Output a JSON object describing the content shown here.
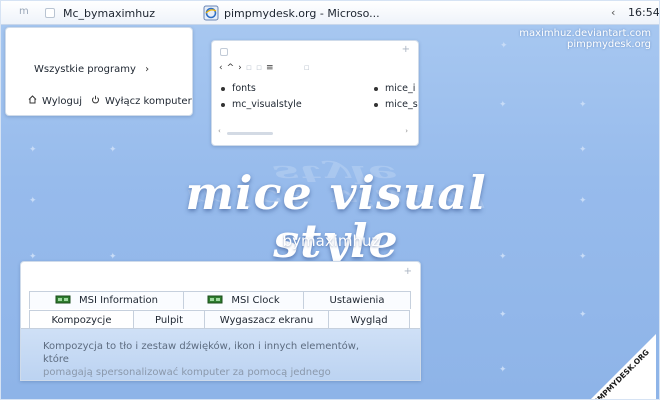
{
  "taskbar": {
    "start_glyph": "m",
    "items": [
      {
        "label": "Mc_bymaximhuz"
      },
      {
        "label": "pimpmydesk.org - Microso..."
      }
    ],
    "tray_arrow": "‹",
    "clock": "16:54"
  },
  "credits": {
    "line1": "maximhuz.deviantart.com",
    "line2": "pimpmydesk.org"
  },
  "start_menu": {
    "all_programs": "Wszystkie programy",
    "all_programs_arrow": "›",
    "logout": "Wyloguj",
    "shutdown": "Wyłącz komputer"
  },
  "explorer": {
    "plus": "+",
    "nav_back": "‹",
    "nav_up": "^",
    "nav_forward": "›",
    "files": [
      {
        "name": "fonts"
      },
      {
        "name": "mc_visualstyle"
      },
      {
        "name": "mice_i"
      },
      {
        "name": "mice_s"
      }
    ]
  },
  "hero": {
    "title": "mice visual style",
    "subtitle": "bymaximhuz"
  },
  "control_panel": {
    "plus": "+",
    "tabs_top": [
      {
        "label": "MSI Information"
      },
      {
        "label": "MSI Clock"
      },
      {
        "label": "Ustawienia"
      }
    ],
    "tabs_bottom": [
      {
        "label": "Kompozycje"
      },
      {
        "label": "Pulpit"
      },
      {
        "label": "Wygaszacz ekranu"
      },
      {
        "label": "Wygląd"
      }
    ],
    "description_line1": "Kompozycja to tło i zestaw dźwięków, ikon i innych elementów, które",
    "description_line2": "pomagają spersonalizować komputer za pomocą jednego kliknięcia."
  },
  "watermark": {
    "text": "PIMPMYDESK.ORG"
  },
  "colors": {
    "desktop_top": "#a9c9f1",
    "desktop_bottom": "#8eb4e8",
    "window_bg": "#ffffff",
    "tab_body": "#cfe0f6"
  }
}
